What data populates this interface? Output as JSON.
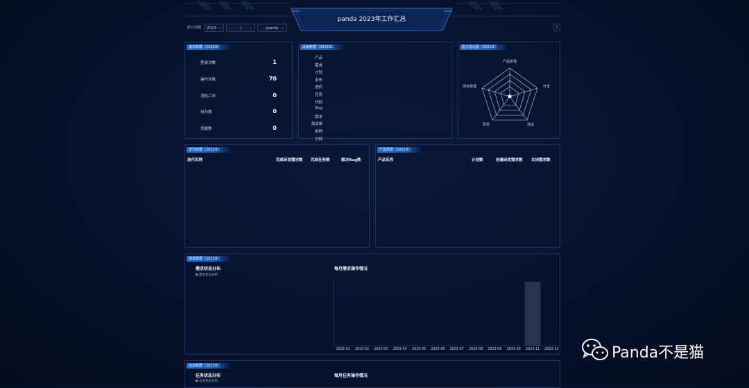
{
  "header": {
    "title": "panda 2023年工作汇总"
  },
  "toolbar": {
    "period_label": "统计范围",
    "year": "2023",
    "month": "/",
    "user": "panda",
    "export_icon": "export-icon"
  },
  "basic": {
    "title": "基本数据（2023年）",
    "rows": [
      {
        "label": "登录次数",
        "value": "1"
      },
      {
        "label": "操作次数",
        "value": "70"
      },
      {
        "label": "消耗工时",
        "value": "0"
      },
      {
        "label": "待办数",
        "value": "0"
      },
      {
        "label": "贡献数",
        "value": "0"
      }
    ]
  },
  "contribution": {
    "title": "贡献数据（2023年）",
    "labels": [
      "产品",
      "需求",
      "计划",
      "发布",
      "迭代",
      "任务",
      "代码",
      "Bug",
      "版本",
      "测试单",
      "用例",
      "文档"
    ]
  },
  "ability": {
    "title": "能力雷达图（2023年）",
    "axes": [
      "产品管理",
      "开发",
      "测试",
      "研发",
      "项目管理"
    ]
  },
  "iteration": {
    "title": "迭代数据（2023年）",
    "columns": [
      "迭代名称",
      "完成研发需求数",
      "完成任务数",
      "解决Bug数"
    ]
  },
  "product": {
    "title": "产品数据（2023年）",
    "columns": [
      "产品名称",
      "计划数",
      "创建研发需求数",
      "关闭需求数"
    ]
  },
  "requirement": {
    "title": "需求数据（2023年）",
    "status_title": "需求状态分布",
    "status_legend": "需求状态分布",
    "monthly_title": "每月需求操作情况"
  },
  "task": {
    "title": "任务数据（2023年）",
    "status_title": "任务状态分布",
    "status_legend": "任务状态分布",
    "monthly_title": "每月任务操作情况"
  },
  "chart_data": {
    "type": "bar",
    "title": "每月需求操作情况",
    "categories": [
      "2023-01",
      "2023-02",
      "2023-03",
      "2023-04",
      "2023-05",
      "2023-06",
      "2023-07",
      "2023-08",
      "2023-09",
      "2023-10",
      "2023-11",
      "2023-12"
    ],
    "values": [
      0,
      0,
      0,
      0,
      0,
      0,
      0,
      0,
      0,
      0,
      1,
      0
    ],
    "ylim": [
      0,
      1
    ],
    "colors": {
      "bar": "#2c3350"
    }
  },
  "watermark": {
    "text": "Panda不是猫"
  }
}
